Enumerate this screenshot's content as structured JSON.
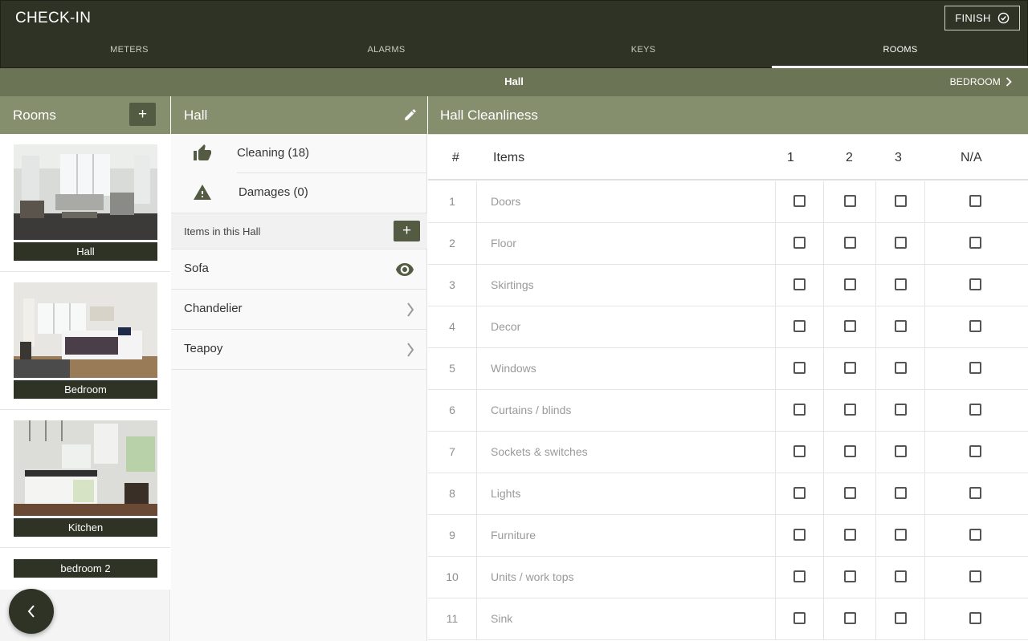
{
  "header": {
    "title": "CHECK-IN",
    "finish_label": "FINISH",
    "tabs": [
      {
        "label": "METERS",
        "active": false
      },
      {
        "label": "ALARMS",
        "active": false
      },
      {
        "label": "KEYS",
        "active": false
      },
      {
        "label": "ROOMS",
        "active": true
      }
    ]
  },
  "subheader": {
    "current_room": "Hall",
    "next_room": "BEDROOM"
  },
  "rooms_panel": {
    "title": "Rooms",
    "add_label": "+",
    "rooms": [
      {
        "label": "Hall"
      },
      {
        "label": "Bedroom"
      },
      {
        "label": "Kitchen"
      },
      {
        "label": "bedroom 2"
      }
    ]
  },
  "hall_panel": {
    "title": "Hall",
    "categories": [
      {
        "label": "Cleaning (18)",
        "icon": "thumbs-up-icon"
      },
      {
        "label": "Damages (0)",
        "icon": "warning-icon"
      }
    ],
    "items_header": "Items in this Hall",
    "items_add_label": "+",
    "items": [
      {
        "label": "Sofa",
        "icon": "eye-icon"
      },
      {
        "label": "Chandelier",
        "icon": "chevron-right-icon"
      },
      {
        "label": "Teapoy",
        "icon": "chevron-right-icon"
      }
    ]
  },
  "cleanliness_panel": {
    "title": "Hall Cleanliness",
    "columns": [
      "#",
      "Items",
      "1",
      "2",
      "3",
      "N/A"
    ],
    "rows": [
      {
        "num": "1",
        "name": "Doors"
      },
      {
        "num": "2",
        "name": "Floor"
      },
      {
        "num": "3",
        "name": "Skirtings"
      },
      {
        "num": "4",
        "name": "Decor"
      },
      {
        "num": "5",
        "name": "Windows"
      },
      {
        "num": "6",
        "name": "Curtains / blinds"
      },
      {
        "num": "7",
        "name": "Sockets & switches"
      },
      {
        "num": "8",
        "name": "Lights"
      },
      {
        "num": "9",
        "name": "Furniture"
      },
      {
        "num": "10",
        "name": "Units / work tops"
      },
      {
        "num": "11",
        "name": "Sink"
      }
    ]
  },
  "colors": {
    "header_bg": "#2e3325",
    "subheader_bg": "#6b7455",
    "panel_head_bg": "#858e6d",
    "accent_button": "#535b42"
  }
}
